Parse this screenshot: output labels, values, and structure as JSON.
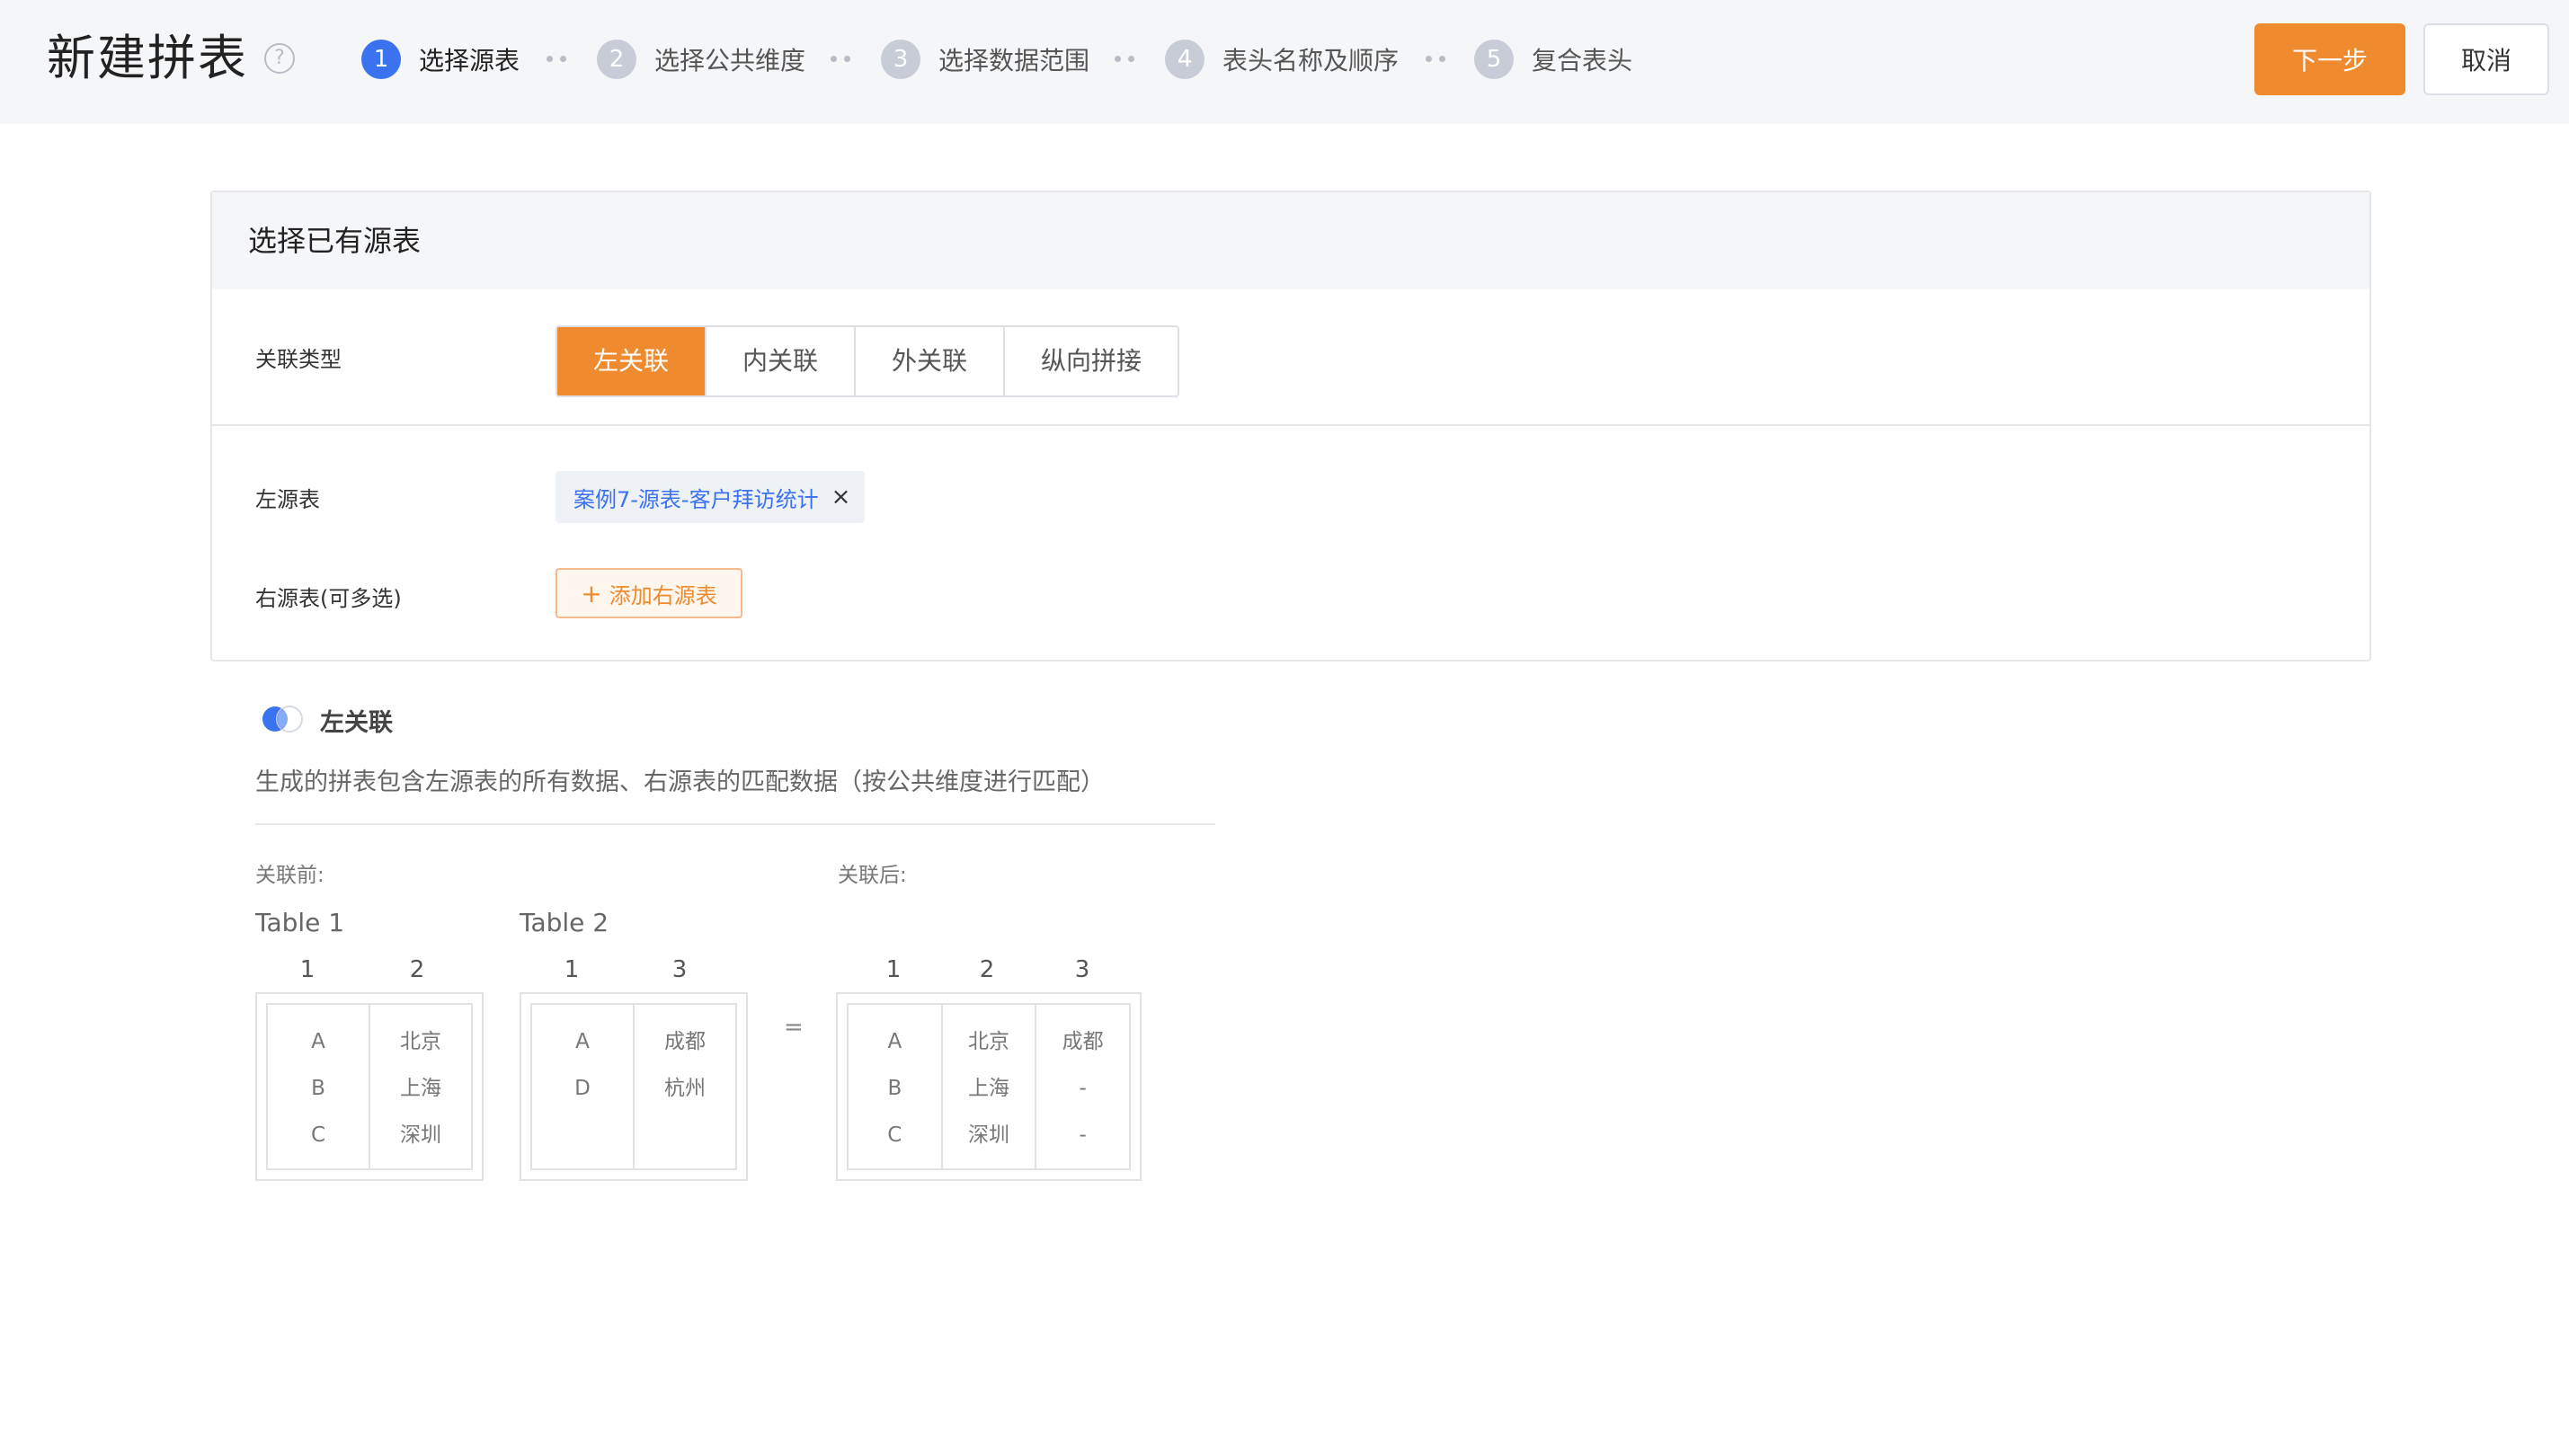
{
  "header": {
    "title": "新建拼表",
    "help_icon": "?",
    "steps": [
      {
        "num": "1",
        "label": "选择源表"
      },
      {
        "num": "2",
        "label": "选择公共维度"
      },
      {
        "num": "3",
        "label": "选择数据范围"
      },
      {
        "num": "4",
        "label": "表头名称及顺序"
      },
      {
        "num": "5",
        "label": "复合表头"
      }
    ],
    "next_label": "下一步",
    "cancel_label": "取消"
  },
  "card": {
    "title": "选择已有源表",
    "join_type_label": "关联类型",
    "join_types": [
      "左关联",
      "内关联",
      "外关联",
      "纵向拼接"
    ],
    "left_source_label": "左源表",
    "left_source_tag": "案例7-源表-客户拜访统计",
    "tag_close": "×",
    "right_source_label": "右源表(可多选)",
    "add_plus": "+",
    "add_right_label": "添加右源表"
  },
  "explain": {
    "title": "左关联",
    "description": "生成的拼表包含左源表的所有数据、右源表的匹配数据（按公共维度进行匹配）",
    "before_label": "关联前:",
    "after_label": "关联后:",
    "equals": "=",
    "table1": {
      "name": "Table 1",
      "headers": [
        "1",
        "2"
      ],
      "columns": [
        [
          "A",
          "B",
          "C"
        ],
        [
          "北京",
          "上海",
          "深圳"
        ]
      ]
    },
    "table2": {
      "name": "Table 2",
      "headers": [
        "1",
        "3"
      ],
      "columns": [
        [
          "A",
          "D"
        ],
        [
          "成都",
          "杭州"
        ]
      ]
    },
    "result": {
      "headers": [
        "1",
        "2",
        "3"
      ],
      "columns": [
        [
          "A",
          "B",
          "C"
        ],
        [
          "北京",
          "上海",
          "深圳"
        ],
        [
          "成都",
          "-",
          "-"
        ]
      ]
    }
  },
  "colors": {
    "accent": "#f08a2e",
    "step_active": "#3b72f0",
    "link": "#3b72f0"
  }
}
